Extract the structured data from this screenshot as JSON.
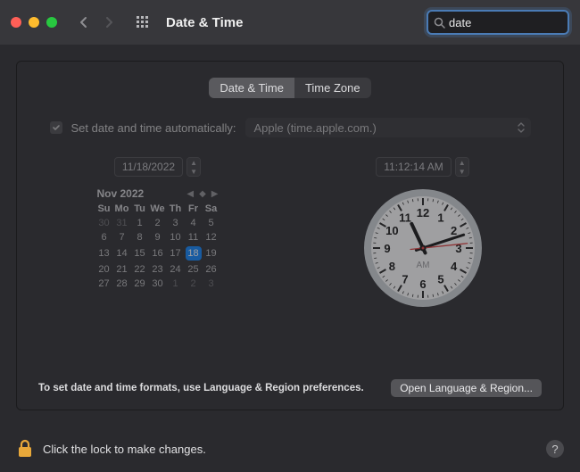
{
  "window": {
    "title": "Date & Time",
    "traffic_colors": {
      "close": "#ff5f57",
      "min": "#febc2e",
      "max": "#28c840"
    }
  },
  "search": {
    "value": "date",
    "placeholder": "Search"
  },
  "tabs": {
    "date_time": "Date & Time",
    "time_zone": "Time Zone"
  },
  "auto": {
    "checkbox_checked": true,
    "label": "Set date and time automatically:",
    "server": "Apple (time.apple.com.)"
  },
  "date_field": "11/18/2022",
  "time_field": "11:12:14 AM",
  "calendar": {
    "month_label": "Nov 2022",
    "weekdays": [
      "Su",
      "Mo",
      "Tu",
      "We",
      "Th",
      "Fr",
      "Sa"
    ],
    "leading_dim": [
      "30",
      "31"
    ],
    "days": [
      "1",
      "2",
      "3",
      "4",
      "5",
      "6",
      "7",
      "8",
      "9",
      "10",
      "11",
      "12",
      "13",
      "14",
      "15",
      "16",
      "17",
      "18",
      "19",
      "20",
      "21",
      "22",
      "23",
      "24",
      "25",
      "26",
      "27",
      "28",
      "29",
      "30"
    ],
    "selected": "18",
    "trailing_dim": [
      "1",
      "2",
      "3"
    ]
  },
  "clock": {
    "numerals": [
      "12",
      "1",
      "2",
      "3",
      "4",
      "5",
      "6",
      "7",
      "8",
      "9",
      "10",
      "11"
    ],
    "ampm": "AM",
    "hour_angle": 335,
    "minute_angle": 72,
    "second_angle": 84
  },
  "footer": {
    "text": "To set date and time formats, use Language & Region preferences.",
    "button": "Open Language & Region..."
  },
  "lock": {
    "text": "Click the lock to make changes."
  }
}
